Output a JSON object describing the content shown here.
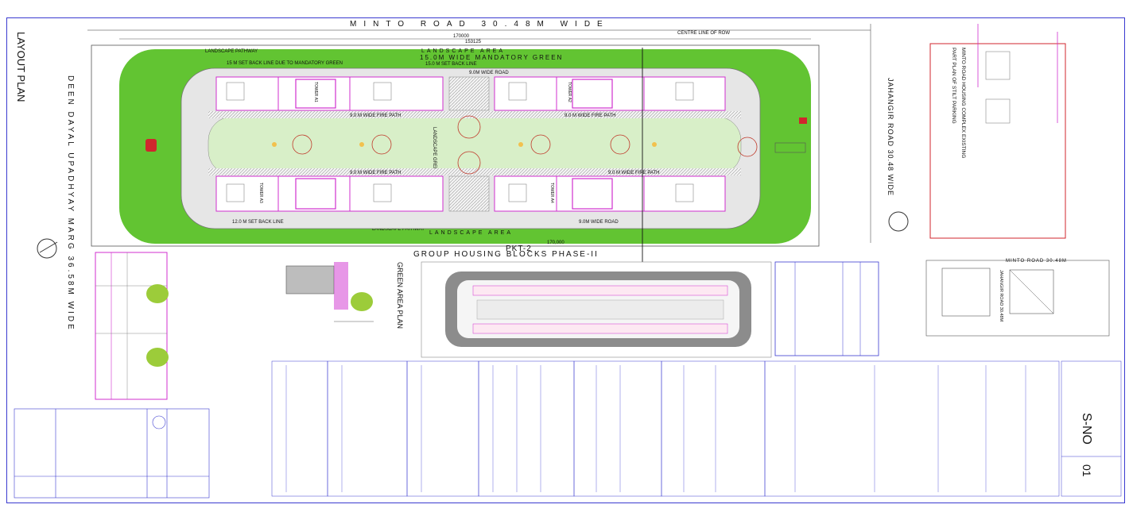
{
  "drawing": {
    "top_road": "MINTO ROAD 30.48M WIDE",
    "right_road": "JAHANGIR ROAD 30.48 WIDE",
    "left_road": "DEEN DAYAL UPADHYAY MARG 36.58M WIDE",
    "centre_line": "CENTRE LINE OF ROW",
    "layout_title": "LAYOUT PLAN",
    "landscape_top": "LANDSCAPE AREA",
    "landscape_bottom": "LANDSCAPE AREA",
    "pathway_top": "LANDSCAPE PATHWAY",
    "pathway_bottom": "LANDSCAPE PATHWAY",
    "mandatory_green": "15.0M WIDE MANDATORY GREEN",
    "setback_top": "15 M SET BACK LINE DUE TO MANDATORY GREEN",
    "setback_top_right": "15.0 M SET BACK LINE",
    "setback_bottom": "12.0 M SET BACK LINE",
    "road_top": "9.0M WIDE ROAD",
    "road_bottom": "9.0M WIDE ROAD",
    "fire_path_1": "9.0 M WIDE FIRE PATH",
    "fire_path_2": "9.0 M WIDE FIRE PATH",
    "fire_path_3": "9.0 M WIDE FIRE PATH",
    "fire_path_4": "9.0 M WIDE FIRE PATH",
    "landscape_green": "LANDSCAPE GREEN",
    "dim_top": "170000",
    "dim_top_inner": "153125",
    "dim_bottom": "170,000",
    "pkt": "PKT-2",
    "group_title": "GROUP HOUSING BLOCKS PHASE-II",
    "green_area_plan": "GREEN AREA PLAN",
    "stilt_note": "PART PLAN OF STILT PARKING",
    "minto_existing": "MINTO ROAD HOUSING COMPLEX EXISTING",
    "key_road": "MINTO ROAD 30.48M",
    "key_jahangir": "JAHANGIR ROAD 30.48M",
    "tower_labels": [
      "TOWER A1",
      "TOWER A2",
      "TOWER A3",
      "TOWER A4"
    ],
    "sheet_no_label": "S-NO",
    "sheet_no": "01"
  },
  "colors": {
    "border": "#3a3ad0",
    "green": "#62c432",
    "dark_green": "#3d8f1f",
    "road": "#e6e6e6",
    "magenta": "#d02fcf",
    "red": "#d0262d",
    "ink": "#2b2b6e"
  }
}
